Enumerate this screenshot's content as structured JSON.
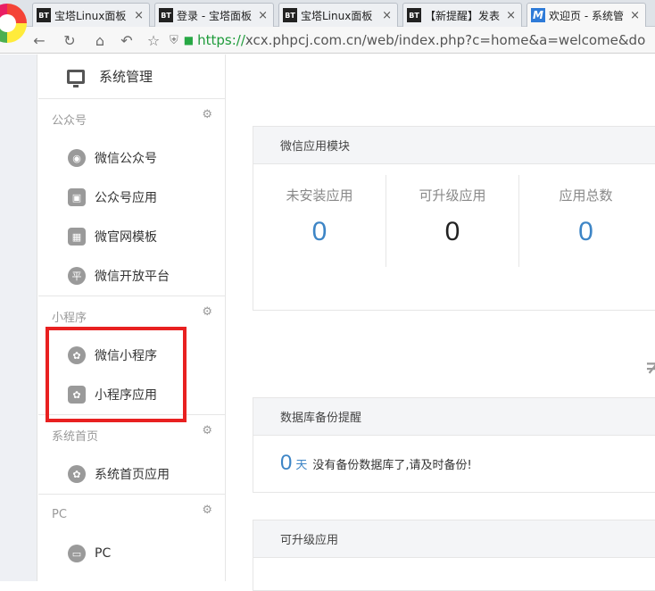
{
  "browser": {
    "tabs": [
      {
        "favicon": "BT",
        "title": "宝塔Linux面板",
        "close": "×"
      },
      {
        "favicon": "BT",
        "title": "登录 - 宝塔面板",
        "close": "×"
      },
      {
        "favicon": "BT",
        "title": "宝塔Linux面板",
        "close": "×"
      },
      {
        "favicon": "BT",
        "title": "【新提醒】发表",
        "close": "×"
      },
      {
        "favicon": "M",
        "title": "欢迎页 - 系统管",
        "close": "×"
      }
    ],
    "url_scheme": "https://",
    "url_rest": "xcx.phpcj.com.cn/web/index.php?c=home&a=welcome&do",
    "icons": {
      "back": "back-arrow-icon",
      "reload": "reload-icon",
      "home": "home-icon",
      "undo": "undo-icon",
      "star": "star-icon"
    }
  },
  "sidebar": {
    "header": "系统管理",
    "groups": [
      {
        "title": "公众号",
        "items": [
          "微信公众号",
          "公众号应用",
          "微官网模板",
          "微信开放平台"
        ]
      },
      {
        "title": "小程序",
        "items": [
          "微信小程序",
          "小程序应用"
        ]
      },
      {
        "title": "系统首页",
        "items": [
          "系统首页应用"
        ]
      },
      {
        "title": "PC",
        "items": [
          "PC"
        ]
      }
    ],
    "icon_glyphs": {
      "open_platform": "平"
    }
  },
  "main": {
    "modules_panel": {
      "title": "微信应用模块",
      "stats": [
        {
          "label": "未安装应用",
          "value": "0"
        },
        {
          "label": "可升级应用",
          "value": "0"
        },
        {
          "label": "应用总数",
          "value": "0"
        }
      ]
    },
    "backup_panel": {
      "title": "数据库备份提醒",
      "days": "0",
      "unit": "天",
      "message": "没有备份数据库了,请及时备份!"
    },
    "upgrade_panel": {
      "title": "可升级应用"
    }
  },
  "colors": {
    "accent_blue": "#3d85c6",
    "highlight_red": "#e82020",
    "url_green": "#1e9b3a"
  }
}
